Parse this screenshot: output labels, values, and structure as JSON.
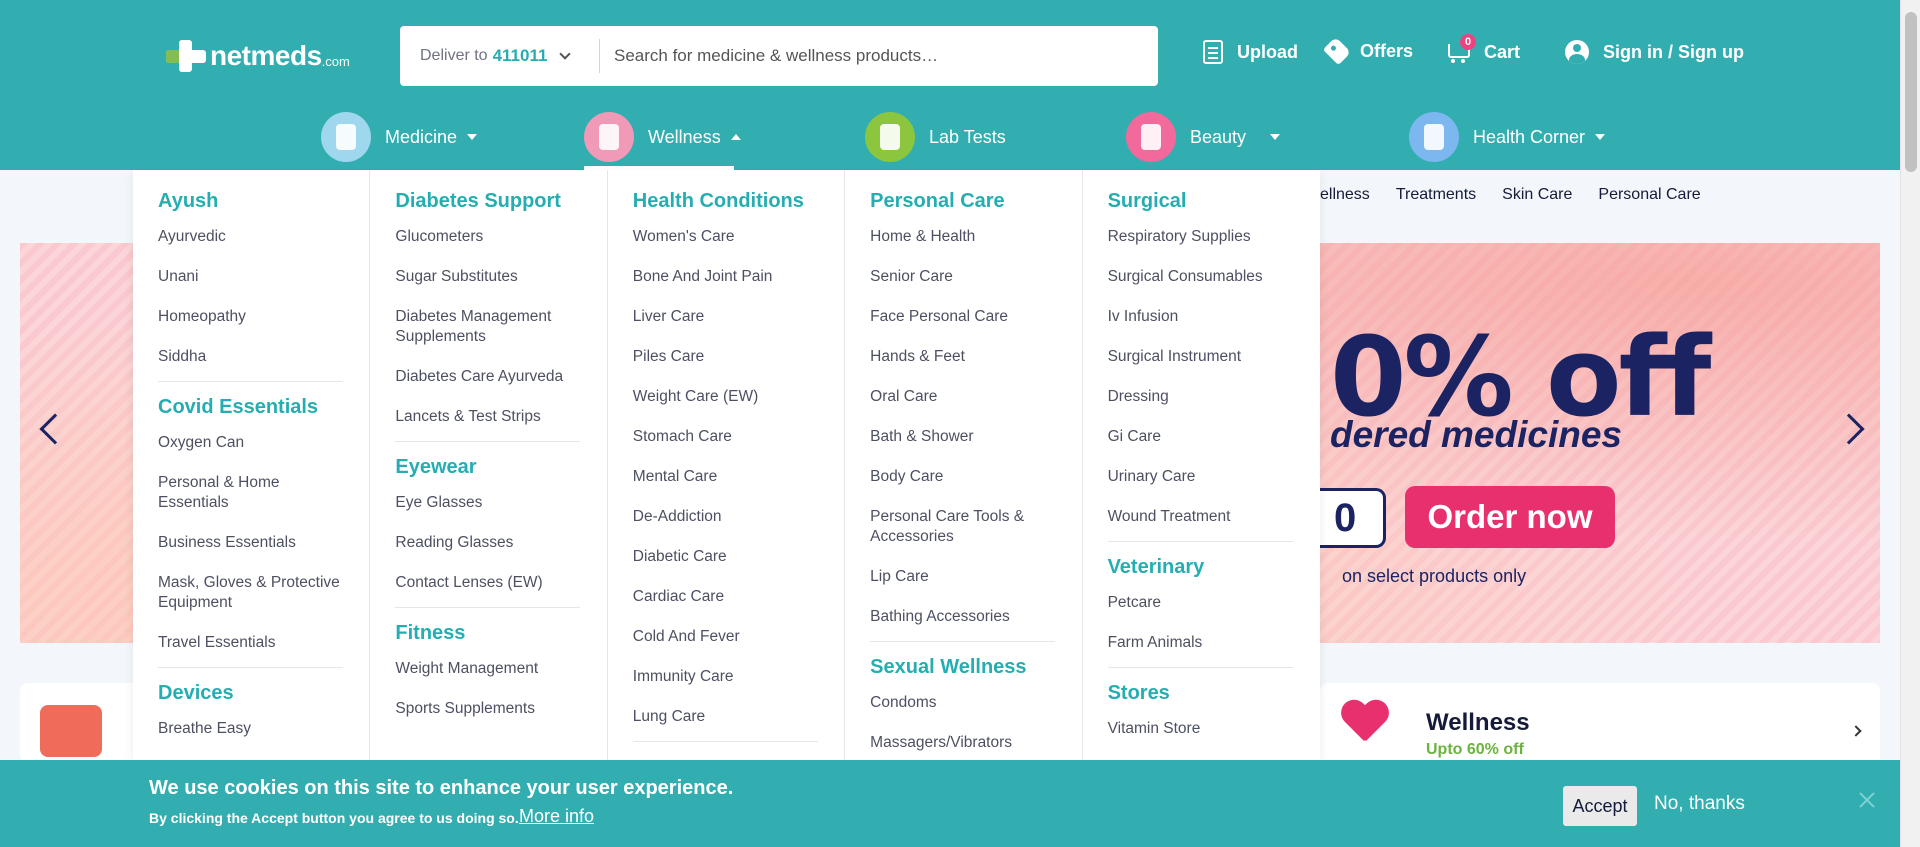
{
  "header": {
    "logo_text": "netmeds",
    "logo_suffix": ".com",
    "deliver_label": "Deliver to",
    "pincode": "411011",
    "search_placeholder": "Search for medicine & wellness products…",
    "upload_label": "Upload",
    "offers_label": "Offers",
    "cart_label": "Cart",
    "cart_count": "0",
    "signin_label": "Sign in / Sign up"
  },
  "categories": [
    {
      "label": "Medicine",
      "color": "#9fd7ee"
    },
    {
      "label": "Wellness",
      "color": "#f09ab8"
    },
    {
      "label": "Lab Tests",
      "color": "#8cc63f"
    },
    {
      "label": "Beauty",
      "color": "#f26a9b"
    },
    {
      "label": "Health Corner",
      "color": "#7db7f0"
    }
  ],
  "subnav": [
    "ellness",
    "Treatments",
    "Skin Care",
    "Personal Care"
  ],
  "banner": {
    "headline": "0% off",
    "subline": "dered medicines",
    "code_fragment": "0",
    "order_button": "Order now",
    "note": "on select products only"
  },
  "wellness_card": {
    "title": "Wellness",
    "subtitle": "Upto 60% off"
  },
  "menu": {
    "col1": {
      "s1_title": "Ayush",
      "s1_items": [
        "Ayurvedic",
        "Unani",
        "Homeopathy",
        "Siddha"
      ],
      "s2_title": "Covid Essentials",
      "s2_items": [
        "Oxygen Can",
        "Personal & Home Essentials",
        "Business Essentials",
        "Mask, Gloves & Protective Equipment",
        "Travel Essentials"
      ],
      "s3_title": "Devices",
      "s3_items": [
        "Breathe Easy"
      ]
    },
    "col2": {
      "s1_title": "Diabetes Support",
      "s1_items": [
        "Glucometers",
        "Sugar Substitutes",
        "Diabetes Management Supplements",
        "Diabetes Care Ayurveda",
        "Lancets & Test Strips"
      ],
      "s2_title": "Eyewear",
      "s2_items": [
        "Eye Glasses",
        "Reading Glasses",
        "Contact Lenses (EW)"
      ],
      "s3_title": "Fitness",
      "s3_items": [
        "Weight Management",
        "Sports Supplements"
      ]
    },
    "col3": {
      "s1_title": "Health Conditions",
      "s1_items": [
        "Women's Care",
        "Bone And Joint Pain",
        "Liver Care",
        "Piles Care",
        "Weight Care (EW)",
        "Stomach Care",
        "Mental Care",
        "De-Addiction",
        "Diabetic Care",
        "Cardiac Care",
        "Cold And Fever",
        "Immunity Care",
        "Lung Care"
      ]
    },
    "col4": {
      "s1_title": "Personal Care",
      "s1_items": [
        "Home & Health",
        "Senior Care",
        "Face Personal Care",
        "Hands & Feet",
        "Oral Care",
        "Bath & Shower",
        "Body Care",
        "Personal Care Tools & Accessories",
        "Lip Care",
        "Bathing Accessories"
      ],
      "s2_title": "Sexual Wellness",
      "s2_items": [
        "Condoms",
        "Massagers/Vibrators"
      ]
    },
    "col5": {
      "s1_title": "Surgical",
      "s1_items": [
        "Respiratory Supplies",
        "Surgical Consumables",
        "Iv Infusion",
        "Surgical Instrument",
        "Dressing",
        "Gi Care",
        "Urinary Care",
        "Wound Treatment"
      ],
      "s2_title": "Veterinary",
      "s2_items": [
        "Petcare",
        "Farm Animals"
      ],
      "s3_title": "Stores",
      "s3_items": [
        "Vitamin Store"
      ]
    }
  },
  "cookie": {
    "title": "We use cookies on this site to enhance your user experience.",
    "text": "By clicking the Accept button you agree to us doing so.",
    "more_info": "More info",
    "accept": "Accept",
    "no_thanks": "No, thanks"
  }
}
